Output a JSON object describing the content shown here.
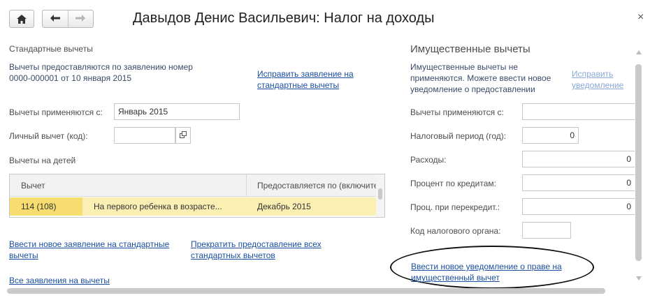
{
  "window": {
    "title": "Давыдов Денис Васильевич: Налог на доходы",
    "close_glyph": "×"
  },
  "standard": {
    "section_title": "Стандартные вычеты",
    "info_line1": "Вычеты предоставляются по заявлению номер",
    "info_line2": "0000-000001 от 10 января 2015",
    "edit_link_line1": "Исправить заявление на",
    "edit_link_line2": "стандартные вычеты",
    "applied_from_label": "Вычеты применяются с:",
    "applied_from_value": "Январь 2015",
    "personal_label": "Личный вычет (код):",
    "personal_value": "",
    "children_title": "Вычеты на детей",
    "table": {
      "headers": [
        "Вычет",
        "Предоставляется по (включите"
      ],
      "rows": [
        {
          "code": "114 (108)",
          "description": "На первого ребенка в возрасте...",
          "until": "Декабрь 2015"
        }
      ]
    },
    "new_app_link_line1": "Ввести новое заявление на стандартные",
    "new_app_link_line2": "вычеты",
    "stop_link_line1": "Прекратить предоставление всех",
    "stop_link_line2": "стандартных вычетов",
    "all_apps_link": "Все заявления на вычеты"
  },
  "property": {
    "section_title": "Имущественные вычеты",
    "info_line1": "Имущественные вычеты не",
    "info_line2": "применяются. Можете ввести новое",
    "info_line3": "уведомление о предоставлении",
    "edit_link_line1": "Исправить",
    "edit_link_line2": "уведомление",
    "fields": [
      {
        "label": "Вычеты применяются с:",
        "value": ""
      },
      {
        "label": "Налоговый период (год):",
        "value": "0"
      },
      {
        "label": "Расходы:",
        "value": "0"
      },
      {
        "label": "Процент по кредитам:",
        "value": "0"
      },
      {
        "label": "Проц. при перекредит.:",
        "value": "0"
      },
      {
        "label": "Код налогового органа:",
        "value": ""
      }
    ],
    "new_notice_link_line1": "Ввести новое уведомление о праве на",
    "new_notice_link_line2": "имущественный вычет"
  },
  "icons": {
    "home": "home-icon",
    "back": "arrow-left-icon",
    "forward": "arrow-right-icon",
    "open_select": "open-form-icon"
  },
  "colors": {
    "section_title": "#2e9a4a",
    "link": "#1b4fa0",
    "row_highlight": "#fbefb4",
    "row_code_cell": "#f7dd6f"
  }
}
